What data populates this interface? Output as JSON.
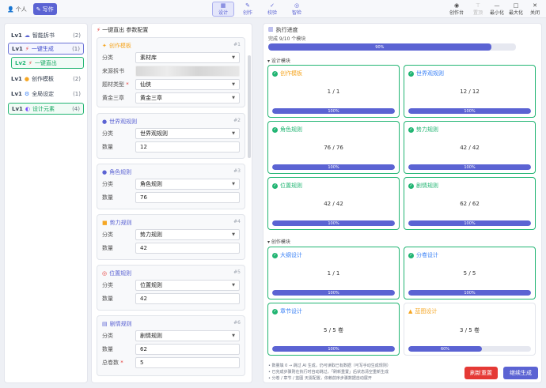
{
  "top": {
    "personal": "个人",
    "write": "写作",
    "nav": [
      {
        "label": "设计",
        "icon": "▦"
      },
      {
        "label": "创作",
        "icon": "✎"
      },
      {
        "label": "校验",
        "icon": "✓"
      },
      {
        "label": "智检",
        "icon": "◎"
      }
    ],
    "right": [
      {
        "label": "创作台",
        "icon": "◉"
      },
      {
        "label": "置顶",
        "icon": "⊤"
      },
      {
        "label": "最小化",
        "icon": "—"
      },
      {
        "label": "最大化",
        "icon": "□"
      },
      {
        "label": "关闭",
        "icon": "✕"
      }
    ]
  },
  "tree": [
    {
      "lv": "Lv1",
      "icon": "☁",
      "label": "智能拆书",
      "count": "(2)"
    },
    {
      "lv": "Lv1",
      "icon": "⚡",
      "label": "一键生成",
      "count": "(1)"
    },
    {
      "lv": "Lv2",
      "icon": "⚡",
      "label": "一键直出",
      "count": ""
    },
    {
      "lv": "Lv1",
      "icon": "●",
      "label": "创作模板",
      "count": "(2)"
    },
    {
      "lv": "Lv1",
      "icon": "⚙",
      "label": "全局设定",
      "count": "(1)"
    },
    {
      "lv": "Lv1",
      "icon": "◐",
      "label": "设计元素",
      "count": "(4)"
    }
  ],
  "mid": {
    "title": "一键直出 参数配置",
    "cards": [
      {
        "title": "创作模板",
        "num": "#1",
        "icon": "✦",
        "rows": [
          {
            "label": "分类",
            "value": "素材库",
            "select": true
          },
          {
            "label": "来源拆书",
            "value": "",
            "blur": true
          },
          {
            "label": "题材类型",
            "value": "仙侠",
            "select": true,
            "req": true
          },
          {
            "label": "黄金三章",
            "value": "黄金三章",
            "select": true
          }
        ]
      },
      {
        "title": "世界观规则",
        "num": "#2",
        "icon": "●",
        "rows": [
          {
            "label": "分类",
            "value": "世界观规则",
            "select": true
          },
          {
            "label": "数量",
            "value": "12"
          }
        ]
      },
      {
        "title": "角色规则",
        "num": "#3",
        "icon": "●",
        "rows": [
          {
            "label": "分类",
            "value": "角色规则",
            "select": true
          },
          {
            "label": "数量",
            "value": "76"
          }
        ]
      },
      {
        "title": "势力规则",
        "num": "#4",
        "icon": "■",
        "rows": [
          {
            "label": "分类",
            "value": "势力规则",
            "select": true
          },
          {
            "label": "数量",
            "value": "42"
          }
        ]
      },
      {
        "title": "位置规则",
        "num": "#5",
        "icon": "◎",
        "rows": [
          {
            "label": "分类",
            "value": "位置规则",
            "select": true
          },
          {
            "label": "数量",
            "value": "42"
          }
        ]
      },
      {
        "title": "剧情规则",
        "num": "#6",
        "icon": "▤",
        "rows": [
          {
            "label": "分类",
            "value": "剧情规则",
            "select": true
          },
          {
            "label": "数量",
            "value": "62"
          },
          {
            "label": "总卷数",
            "value": "5",
            "req": true
          }
        ]
      }
    ]
  },
  "progress": {
    "title": "执行进度",
    "summary": "完成 9/10 个模块",
    "overall": "90%",
    "overall_value": 90,
    "design_label": "设计模块",
    "create_label": "创作模块",
    "design": [
      {
        "title": "创作模板",
        "value": "1 / 1",
        "pct": "100%",
        "p": 100,
        "color": "#f5a623"
      },
      {
        "title": "世界观规则",
        "value": "12 / 12",
        "pct": "100%",
        "p": 100,
        "color": "#3b82f6"
      },
      {
        "title": "角色规则",
        "value": "76 / 76",
        "pct": "100%",
        "p": 100,
        "color": "#22b573"
      },
      {
        "title": "势力规则",
        "value": "42 / 42",
        "pct": "100%",
        "p": 100,
        "color": "#22b573"
      },
      {
        "title": "位置规则",
        "value": "42 / 42",
        "pct": "100%",
        "p": 100,
        "color": "#22b573"
      },
      {
        "title": "剧情规则",
        "value": "62 / 62",
        "pct": "100%",
        "p": 100,
        "color": "#22b573"
      }
    ],
    "create": [
      {
        "title": "大纲设计",
        "value": "1 / 1",
        "pct": "100%",
        "p": 100,
        "color": "#3b82f6"
      },
      {
        "title": "分卷设计",
        "value": "5 / 5",
        "pct": "100%",
        "p": 100,
        "color": "#3b82f6"
      },
      {
        "title": "章节设计",
        "value": "5 / 5 卷",
        "pct": "100%",
        "p": 100,
        "color": "#3b82f6"
      },
      {
        "title": "蓝图设计",
        "value": "3 / 5 卷",
        "pct": "60%",
        "p": 60,
        "color": "#f5a623",
        "warn": true
      }
    ],
    "notes": [
      "• 数量填 0 → 跳过 AI 生成，仍可读取已有数据（可写手动生成规则）",
      "• 已完成步骤则在执行时自动跳过，「刷新重置」后状态清空重新生成",
      "• 分卷 / 章节 / 蓝图 天需配置，依赖前序步骤数据自动展开"
    ],
    "reset": "刷新重置",
    "continue": "继续生成"
  }
}
